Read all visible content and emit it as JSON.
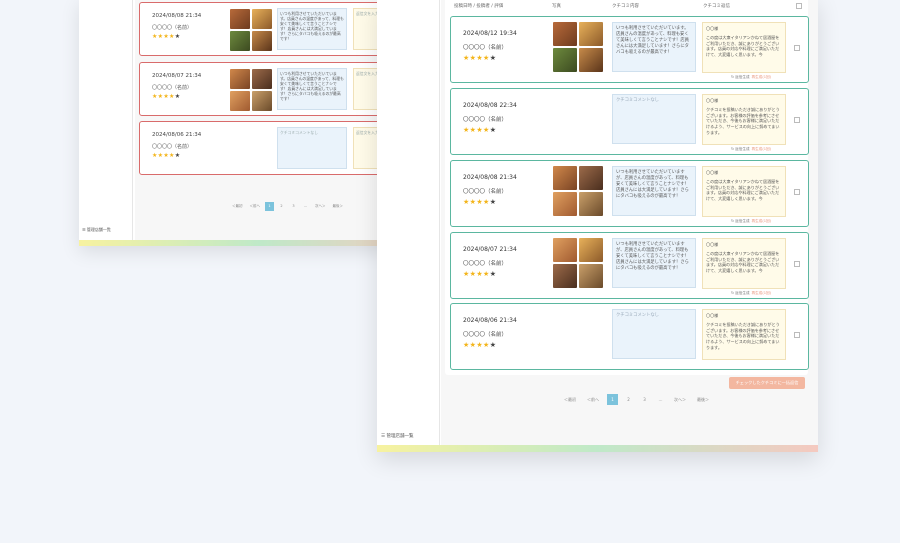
{
  "back_window": {
    "sidebar_item": "☰ 管理店舗一覧",
    "reviews": [
      {
        "date": "2024/08/08 21:34",
        "name": "〇〇〇〇（名前）",
        "stars": "★★★★",
        "comment": "いつも利用させていただいています。店員さんの温度があって、料理も安くて美味しくて言うことナシです！店員さんには大満足しています！さらにタバコも吸えるのが最高です！",
        "reply": "返信文を入力…"
      },
      {
        "date": "2024/08/07 21:34",
        "name": "〇〇〇〇（名前）",
        "stars": "★★★★",
        "comment": "いつも利用させていただいています。店員さんの温度があって、料理も安くて美味しくて言うことナシです！店員さんには大満足しています！さらにタバコも吸えるのが最高です！",
        "reply": "返信文を入力…"
      },
      {
        "date": "2024/08/06 21:34",
        "name": "〇〇〇〇（名前）",
        "stars": "★★★★",
        "comment": "クチコミコメントなし",
        "reply": "返信文を入力…"
      }
    ],
    "pager": [
      "＜最初",
      "＜前へ",
      "1",
      "2",
      "3",
      "…",
      "次へ＞",
      "最後＞"
    ]
  },
  "front_window": {
    "sidebar_item": "☰ 管理店舗一覧",
    "headers": {
      "info": "投稿日時 / 投稿者 / 評価",
      "photo": "写真",
      "comment": "クチコミ内容",
      "reply": "クチコミ返信"
    },
    "reviews": [
      {
        "date": "2024/08/12  19:34",
        "name": "〇〇〇〇（名前）",
        "stars": "★★★★",
        "comment": "いつも利用させていただいています。店員さんの温度があって、料理も安くて美味しくて言うことナシです！店員さんには大満足しています！さらにタバコも吸えるのが最高です！",
        "salute": "〇〇様",
        "reply": "この度は大衆イタリアンかねて居酒屋をご利用いただき、誠にありがとうございます。店員の対応や料理にご満足いただけて、大変嬉しく思います。今",
        "foot_label": "返信生成",
        "foot_link": "再生成(1回)",
        "has_photos": true
      },
      {
        "date": "2024/08/08  22:34",
        "name": "〇〇〇〇（名前）",
        "stars": "★★★★",
        "comment": "クチコミコメントなし",
        "salute": "〇〇様",
        "reply": "クチコミを投稿いただき誠にありがとうございます。お客様の評価を参考にさせていただき、今後もお客様に満足いただけるよう、サービスの向上に努めてまいります。",
        "foot_label": "返信生成",
        "foot_link": "再生成(1回)",
        "has_photos": false
      },
      {
        "date": "2024/08/08  21:34",
        "name": "〇〇〇〇（名前）",
        "stars": "★★★★",
        "comment": "いつも利用させていただいていますが、店員さんの温度があって、料理も安くて美味しくて言うことナシです！店員さんには大満足しています！さらにタバコも吸えるのが最高です！",
        "salute": "〇〇様",
        "reply": "この度は大衆イタリアンかねて居酒屋をご利用いただき、誠にありがとうございます。店員の対応や料理にご満足いただけて、大変嬉しく思います。今",
        "foot_label": "返信生成",
        "foot_link": "再生成(1回)",
        "has_photos": true
      },
      {
        "date": "2024/08/07  21:34",
        "name": "〇〇〇〇（名前）",
        "stars": "★★★★",
        "comment": "いつも利用させていただいていますが、店員さんの温度があって、料理も安くて美味しくて言うことナシです！店員さんには大満足しています！さらにタバコも吸えるのが最高です！",
        "salute": "〇〇様",
        "reply": "この度は大衆イタリアンかねて居酒屋をご利用いただき、誠にありがとうございます。店員の対応や料理にご満足いただけて、大変嬉しく思います。今",
        "foot_label": "返信生成",
        "foot_link": "再生成(1回)",
        "has_photos": true
      },
      {
        "date": "2024/08/06  21:34",
        "name": "〇〇〇〇（名前）",
        "stars": "★★★★",
        "comment": "クチコミコメントなし",
        "salute": "〇〇様",
        "reply": "クチコミを投稿いただき誠にありがとうございます。お客様の評価を参考にさせていただき、今後もお客様に満足いただけるよう、サービスの向上に努めてまいります。",
        "foot_label": "返信生成",
        "foot_link": "再生成(1回)",
        "has_photos": false
      }
    ],
    "button_label": "チェックしたクチコミに一括返信",
    "pager": [
      "＜最初",
      "＜前へ",
      "1",
      "2",
      "3",
      "…",
      "次へ＞",
      "最後＞"
    ]
  },
  "colors": {
    "accent_green": "#5bb7a0",
    "accent_red": "#d96b6b",
    "star": "#f3b51b",
    "pager_active": "#7cc3dc",
    "button": "#f3b7a0"
  }
}
